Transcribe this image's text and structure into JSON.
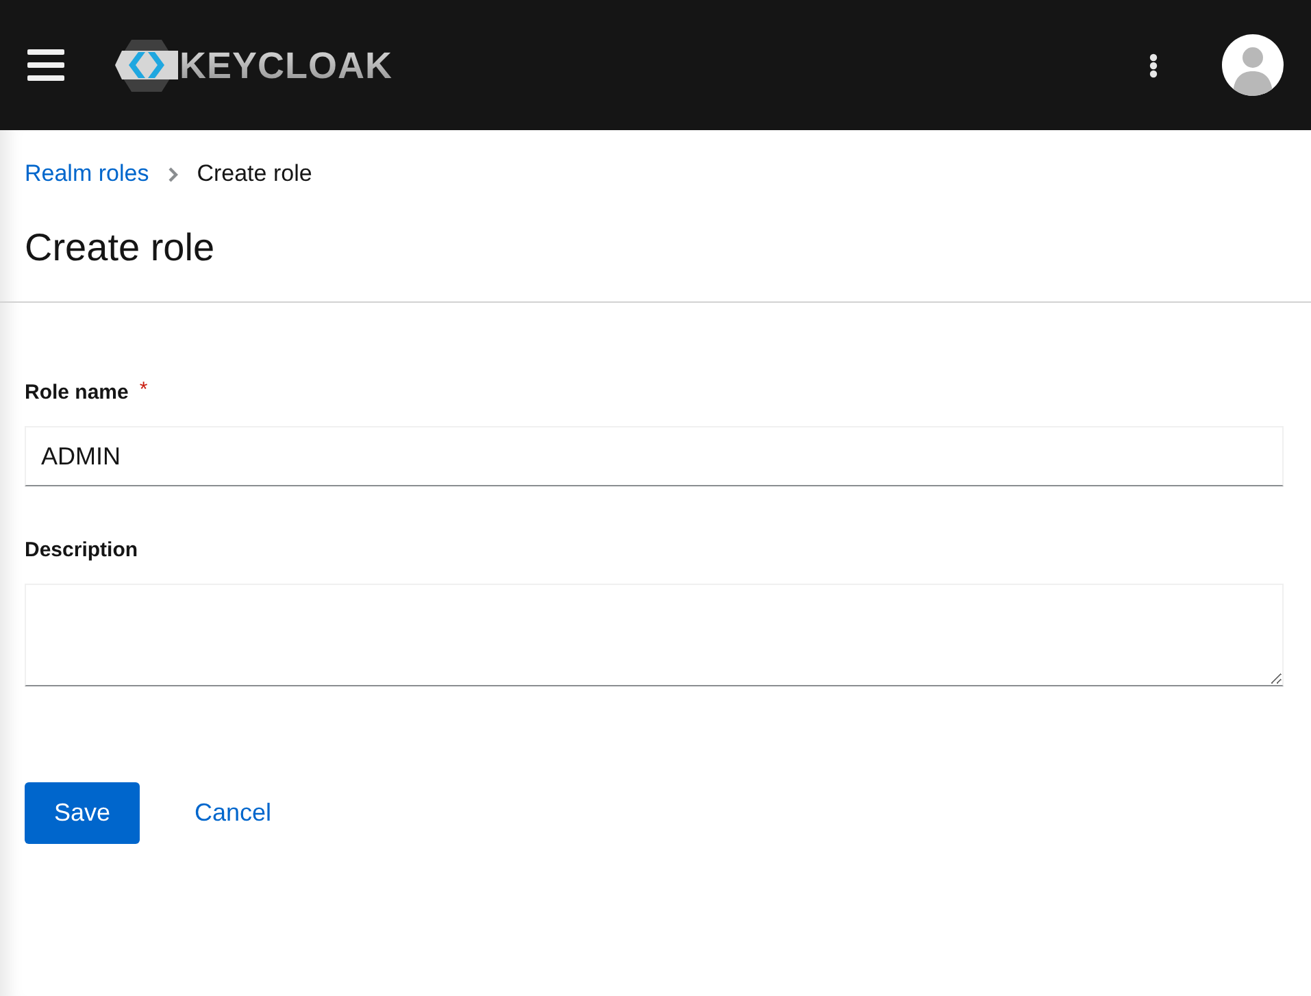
{
  "header": {
    "logo_text": "KEYCLOAK"
  },
  "breadcrumb": [
    {
      "label": "Realm roles",
      "kind": "link"
    },
    {
      "label": "Create role",
      "kind": "current"
    }
  ],
  "page_title": "Create role",
  "form": {
    "fields": [
      {
        "label": "Role name",
        "required_mark": "*",
        "kind": "input",
        "value": "ADMIN"
      },
      {
        "label": "Description",
        "kind": "textarea"
      }
    ]
  },
  "actions": [
    {
      "label": "Save",
      "kind": "primary"
    },
    {
      "label": "Cancel",
      "kind": "link"
    }
  ]
}
